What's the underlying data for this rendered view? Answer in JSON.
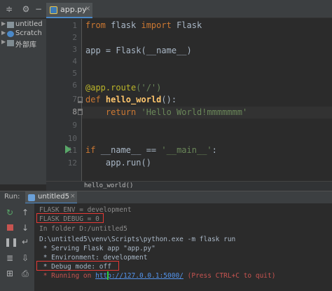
{
  "editor": {
    "tab_label": "app.py",
    "tab_close": "×",
    "line_numbers": [
      "1",
      "2",
      "3",
      "4",
      "5",
      "6",
      "7",
      "8",
      "9",
      "10",
      "11",
      "12"
    ],
    "code": {
      "l1_kw1": "from",
      "l1_mod": " flask ",
      "l1_kw2": "import",
      "l1_name": " Flask",
      "l3": "app = Flask(__name__)",
      "l6_dec": "@app.route",
      "l6_rest": "('/')",
      "l7_kw": "def ",
      "l7_fn": "hello_world",
      "l7_rest": "():",
      "l8_kw": "    return ",
      "l8_str": "'Hello World!mmmmmmm'",
      "l11_kw": "if ",
      "l11_mid": "__name__ == ",
      "l11_str": "'__main__'",
      "l11_end": ":",
      "l12": "    app.run()"
    },
    "breadcrumb": "hello_world()"
  },
  "project_tree": {
    "items": [
      {
        "label": "untitled"
      },
      {
        "label": "Scratch"
      },
      {
        "label": "外部库"
      }
    ]
  },
  "run_panel": {
    "title": "Run:",
    "tab_label": "untitled5",
    "tab_close": "×",
    "console": [
      "FLASK_ENV = development",
      "FLASK_DEBUG = 0",
      "In folder D:/untitled5",
      "D:\\untitled5\\venv\\Scripts\\python.exe -m flask run",
      " * Serving Flask app \"app.py\"",
      " * Environment: development",
      " * Debug mode: off"
    ],
    "running_prefix": " * Running on ",
    "running_url": "http://127.0.0.1:5000/",
    "running_suffix": " (Press CTRL+C to quit)"
  }
}
